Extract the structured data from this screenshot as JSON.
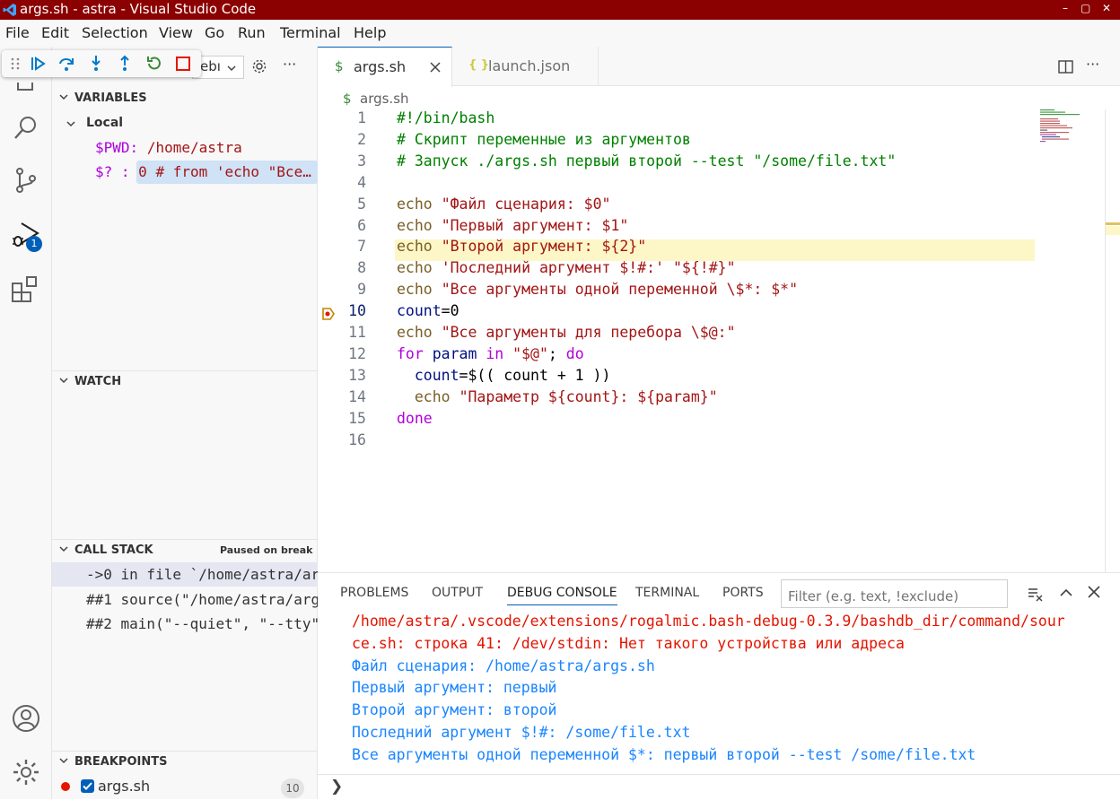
{
  "window": {
    "title": "args.sh - astra - Visual Studio Code",
    "minimize": "–",
    "restore": "▢",
    "close": "✕"
  },
  "menu": [
    "File",
    "Edit",
    "Selection",
    "View",
    "Go",
    "Run",
    "Terminal",
    "Help"
  ],
  "activity": {
    "debug_badge": "1"
  },
  "run_debug": {
    "config_label": "ebı"
  },
  "variables": {
    "header": "VARIABLES",
    "scope": "Local",
    "items": [
      {
        "name": "$PWD:",
        "value": "/home/astra"
      },
      {
        "name": "$? :",
        "value": "0 # from 'echo \"Все…"
      }
    ]
  },
  "watch": {
    "header": "WATCH"
  },
  "callstack": {
    "header": "CALL STACK",
    "status": "Paused on break",
    "frames": [
      "->0 in file `/home/astra/ar",
      "##1 source(\"/home/astra/arg",
      "##2 main(\"--quiet\", \"--tty\""
    ]
  },
  "breakpoints": {
    "header": "BREAKPOINTS",
    "file": "args.sh",
    "line_count": "10"
  },
  "editor": {
    "tabs": [
      {
        "label": "args.sh",
        "icon": "$"
      },
      {
        "label": "launch.json",
        "icon": "{ }"
      }
    ],
    "breadcrumb_icon": "$",
    "breadcrumb": "args.sh",
    "current_line": 10,
    "lines": [
      {
        "n": "1",
        "text": "#!/bin/bash"
      },
      {
        "n": "2",
        "text": "# Скрипт переменные из аргументов"
      },
      {
        "n": "3",
        "text": "# Запуск ./args.sh первый второй --test \"/some/file.txt\""
      },
      {
        "n": "4",
        "text": ""
      },
      {
        "n": "5",
        "text": "echo \"Файл сценария: $0\""
      },
      {
        "n": "6",
        "text": "echo \"Первый аргумент: $1\""
      },
      {
        "n": "7",
        "text": "echo \"Второй аргумент: ${2}\""
      },
      {
        "n": "8",
        "text": "echo 'Последний аргумент $!#:' \"${!#}\""
      },
      {
        "n": "9",
        "text": "echo \"Все аргументы одной переменной \\$*: $*\""
      },
      {
        "n": "10",
        "text": "count=0"
      },
      {
        "n": "11",
        "text": "echo \"Все аргументы для перебора \\$@:\""
      },
      {
        "n": "12",
        "text": "for param in \"$@\"; do"
      },
      {
        "n": "13",
        "text": "  count=$(( count + 1 ))"
      },
      {
        "n": "14",
        "text": "  echo \"Параметр ${count}: ${param}\""
      },
      {
        "n": "15",
        "text": "done"
      },
      {
        "n": "16",
        "text": ""
      }
    ]
  },
  "panel": {
    "tabs": [
      "PROBLEMS",
      "OUTPUT",
      "DEBUG CONSOLE",
      "TERMINAL",
      "PORTS"
    ],
    "active_tab": "DEBUG CONSOLE",
    "filter_placeholder": "Filter (e.g. text, !exclude)",
    "console": [
      {
        "type": "err",
        "text": "/home/astra/.vscode/extensions/rogalmic.bash-debug-0.3.9/bashdb_dir/command/sour"
      },
      {
        "type": "err",
        "text": "ce.sh: строка 41: /dev/stdin: Нет такого устройства или адреса"
      },
      {
        "type": "out",
        "text": "Файл сценария: /home/astra/args.sh"
      },
      {
        "type": "out",
        "text": "Первый аргумент: первый"
      },
      {
        "type": "out",
        "text": "Второй аргумент: второй"
      },
      {
        "type": "out",
        "text": "Последний аргумент $!#: /some/file.txt"
      },
      {
        "type": "out",
        "text": "Все аргументы одной переменной $*: первый второй --test /some/file.txt"
      }
    ],
    "prompt": "❯"
  },
  "colors": {
    "titlebar": "#8b0000",
    "accent": "#005fb8",
    "current_line": "#fdf6c7",
    "error": "#e51400",
    "output": "#1a85ff"
  }
}
